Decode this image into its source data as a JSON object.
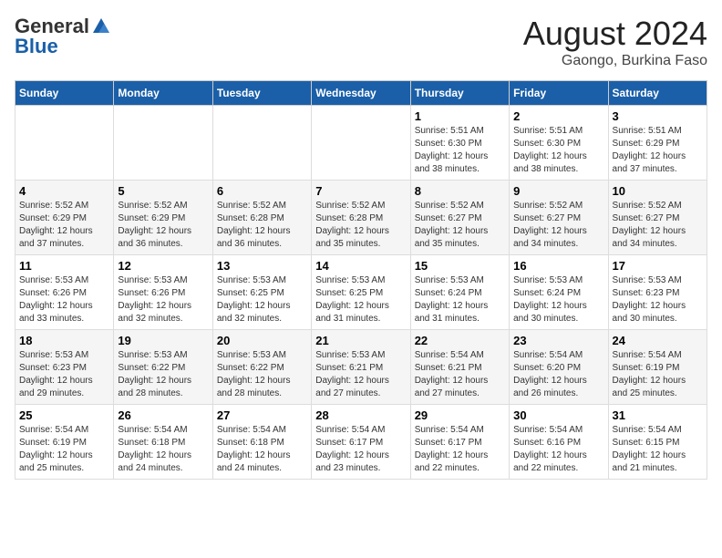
{
  "header": {
    "logo_general": "General",
    "logo_blue": "Blue",
    "main_title": "August 2024",
    "subtitle": "Gaongo, Burkina Faso"
  },
  "calendar": {
    "days_of_week": [
      "Sunday",
      "Monday",
      "Tuesday",
      "Wednesday",
      "Thursday",
      "Friday",
      "Saturday"
    ],
    "weeks": [
      [
        {
          "day": "",
          "info": ""
        },
        {
          "day": "",
          "info": ""
        },
        {
          "day": "",
          "info": ""
        },
        {
          "day": "",
          "info": ""
        },
        {
          "day": "1",
          "info": "Sunrise: 5:51 AM\nSunset: 6:30 PM\nDaylight: 12 hours\nand 38 minutes."
        },
        {
          "day": "2",
          "info": "Sunrise: 5:51 AM\nSunset: 6:30 PM\nDaylight: 12 hours\nand 38 minutes."
        },
        {
          "day": "3",
          "info": "Sunrise: 5:51 AM\nSunset: 6:29 PM\nDaylight: 12 hours\nand 37 minutes."
        }
      ],
      [
        {
          "day": "4",
          "info": "Sunrise: 5:52 AM\nSunset: 6:29 PM\nDaylight: 12 hours\nand 37 minutes."
        },
        {
          "day": "5",
          "info": "Sunrise: 5:52 AM\nSunset: 6:29 PM\nDaylight: 12 hours\nand 36 minutes."
        },
        {
          "day": "6",
          "info": "Sunrise: 5:52 AM\nSunset: 6:28 PM\nDaylight: 12 hours\nand 36 minutes."
        },
        {
          "day": "7",
          "info": "Sunrise: 5:52 AM\nSunset: 6:28 PM\nDaylight: 12 hours\nand 35 minutes."
        },
        {
          "day": "8",
          "info": "Sunrise: 5:52 AM\nSunset: 6:27 PM\nDaylight: 12 hours\nand 35 minutes."
        },
        {
          "day": "9",
          "info": "Sunrise: 5:52 AM\nSunset: 6:27 PM\nDaylight: 12 hours\nand 34 minutes."
        },
        {
          "day": "10",
          "info": "Sunrise: 5:52 AM\nSunset: 6:27 PM\nDaylight: 12 hours\nand 34 minutes."
        }
      ],
      [
        {
          "day": "11",
          "info": "Sunrise: 5:53 AM\nSunset: 6:26 PM\nDaylight: 12 hours\nand 33 minutes."
        },
        {
          "day": "12",
          "info": "Sunrise: 5:53 AM\nSunset: 6:26 PM\nDaylight: 12 hours\nand 32 minutes."
        },
        {
          "day": "13",
          "info": "Sunrise: 5:53 AM\nSunset: 6:25 PM\nDaylight: 12 hours\nand 32 minutes."
        },
        {
          "day": "14",
          "info": "Sunrise: 5:53 AM\nSunset: 6:25 PM\nDaylight: 12 hours\nand 31 minutes."
        },
        {
          "day": "15",
          "info": "Sunrise: 5:53 AM\nSunset: 6:24 PM\nDaylight: 12 hours\nand 31 minutes."
        },
        {
          "day": "16",
          "info": "Sunrise: 5:53 AM\nSunset: 6:24 PM\nDaylight: 12 hours\nand 30 minutes."
        },
        {
          "day": "17",
          "info": "Sunrise: 5:53 AM\nSunset: 6:23 PM\nDaylight: 12 hours\nand 30 minutes."
        }
      ],
      [
        {
          "day": "18",
          "info": "Sunrise: 5:53 AM\nSunset: 6:23 PM\nDaylight: 12 hours\nand 29 minutes."
        },
        {
          "day": "19",
          "info": "Sunrise: 5:53 AM\nSunset: 6:22 PM\nDaylight: 12 hours\nand 28 minutes."
        },
        {
          "day": "20",
          "info": "Sunrise: 5:53 AM\nSunset: 6:22 PM\nDaylight: 12 hours\nand 28 minutes."
        },
        {
          "day": "21",
          "info": "Sunrise: 5:53 AM\nSunset: 6:21 PM\nDaylight: 12 hours\nand 27 minutes."
        },
        {
          "day": "22",
          "info": "Sunrise: 5:54 AM\nSunset: 6:21 PM\nDaylight: 12 hours\nand 27 minutes."
        },
        {
          "day": "23",
          "info": "Sunrise: 5:54 AM\nSunset: 6:20 PM\nDaylight: 12 hours\nand 26 minutes."
        },
        {
          "day": "24",
          "info": "Sunrise: 5:54 AM\nSunset: 6:19 PM\nDaylight: 12 hours\nand 25 minutes."
        }
      ],
      [
        {
          "day": "25",
          "info": "Sunrise: 5:54 AM\nSunset: 6:19 PM\nDaylight: 12 hours\nand 25 minutes."
        },
        {
          "day": "26",
          "info": "Sunrise: 5:54 AM\nSunset: 6:18 PM\nDaylight: 12 hours\nand 24 minutes."
        },
        {
          "day": "27",
          "info": "Sunrise: 5:54 AM\nSunset: 6:18 PM\nDaylight: 12 hours\nand 24 minutes."
        },
        {
          "day": "28",
          "info": "Sunrise: 5:54 AM\nSunset: 6:17 PM\nDaylight: 12 hours\nand 23 minutes."
        },
        {
          "day": "29",
          "info": "Sunrise: 5:54 AM\nSunset: 6:17 PM\nDaylight: 12 hours\nand 22 minutes."
        },
        {
          "day": "30",
          "info": "Sunrise: 5:54 AM\nSunset: 6:16 PM\nDaylight: 12 hours\nand 22 minutes."
        },
        {
          "day": "31",
          "info": "Sunrise: 5:54 AM\nSunset: 6:15 PM\nDaylight: 12 hours\nand 21 minutes."
        }
      ]
    ]
  }
}
